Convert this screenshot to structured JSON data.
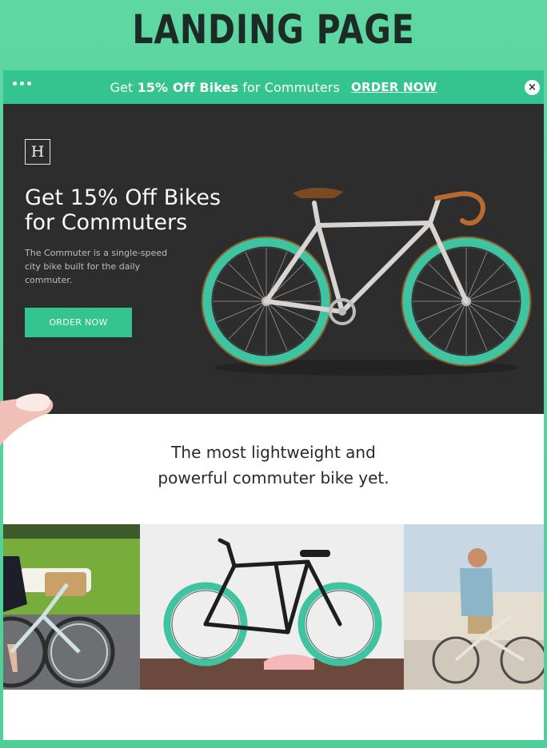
{
  "page": {
    "heading": "LANDING PAGE"
  },
  "promo_bar": {
    "text_prefix": "Get ",
    "text_bold": "15% Off Bikes",
    "text_suffix": " for Commuters",
    "link_label": "ORDER NOW",
    "close_symbol": "×"
  },
  "hero": {
    "logo_letter": "H",
    "title_line1": "Get 15% Off Bikes",
    "title_line2": "for Commuters",
    "description": "The Commuter is a single-speed city bike built for the daily commuter.",
    "cta_label": "ORDER NOW"
  },
  "content": {
    "tagline_line1": "The most lightweight and",
    "tagline_line2": "powerful commuter bike yet."
  },
  "colors": {
    "accent": "#34c48f",
    "page_background": "#5fd7a3",
    "hero_background": "#2e2d2d",
    "rim": "#3fc3a0"
  },
  "icons": [
    "menu-dots-icon",
    "close-icon",
    "logo-icon",
    "bicycle-icon"
  ]
}
